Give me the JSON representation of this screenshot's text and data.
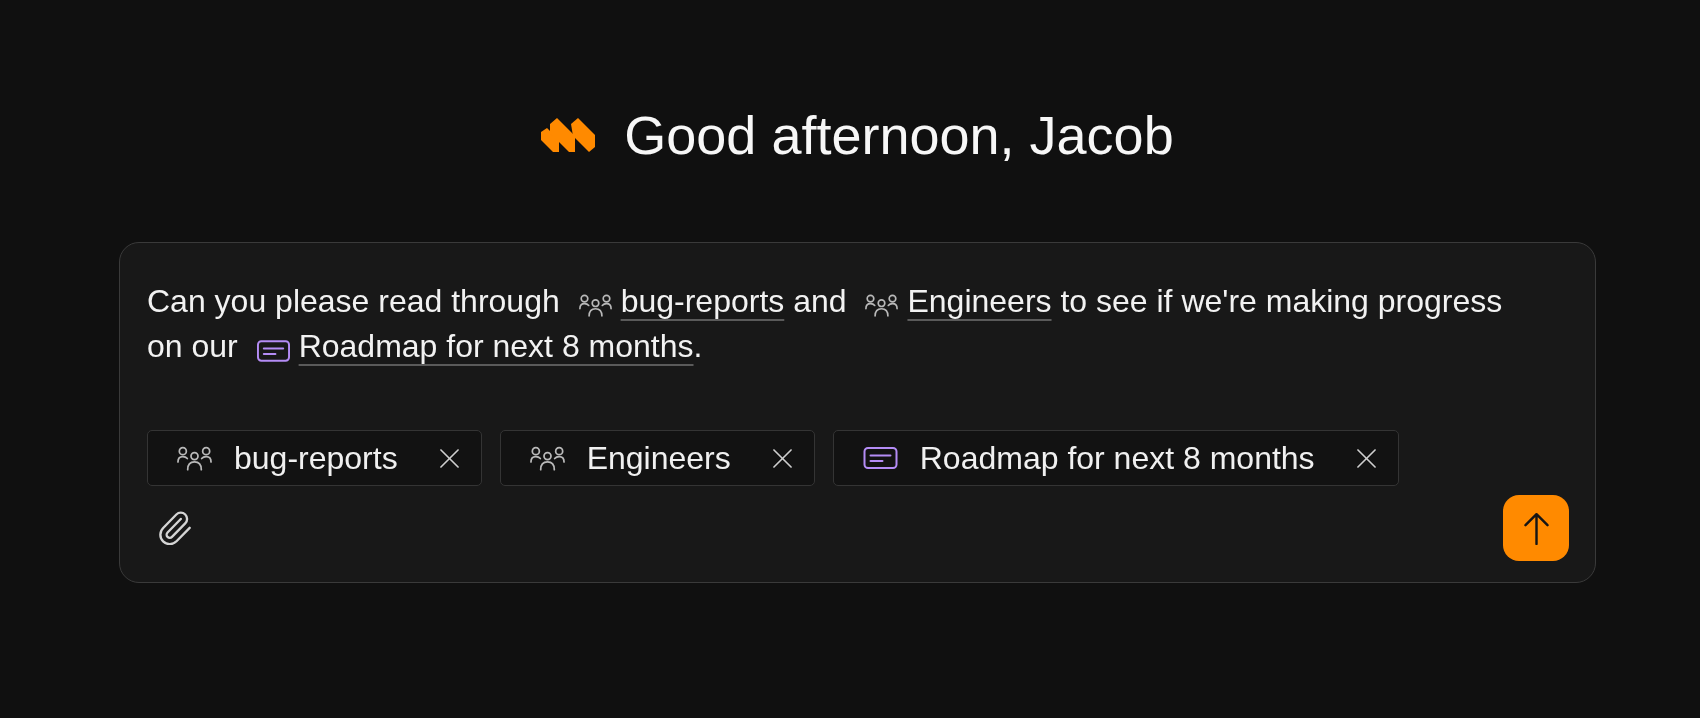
{
  "header": {
    "title": "Good afternoon, Jacob"
  },
  "composer": {
    "message": [
      {
        "kind": "text",
        "text": "Can you please read through "
      },
      {
        "kind": "group",
        "text": "bug-reports"
      },
      {
        "kind": "text",
        "text": " and "
      },
      {
        "kind": "group",
        "text": "Engineers"
      },
      {
        "kind": "text",
        "text": " to see if we're making progress on our "
      },
      {
        "kind": "document",
        "text": "Roadmap for next 8 months"
      },
      {
        "kind": "text",
        "text": "."
      }
    ],
    "attachments": [
      {
        "kind": "group",
        "label": "bug-reports"
      },
      {
        "kind": "group",
        "label": "Engineers"
      },
      {
        "kind": "document",
        "label": "Roadmap for next 8 months"
      }
    ]
  }
}
